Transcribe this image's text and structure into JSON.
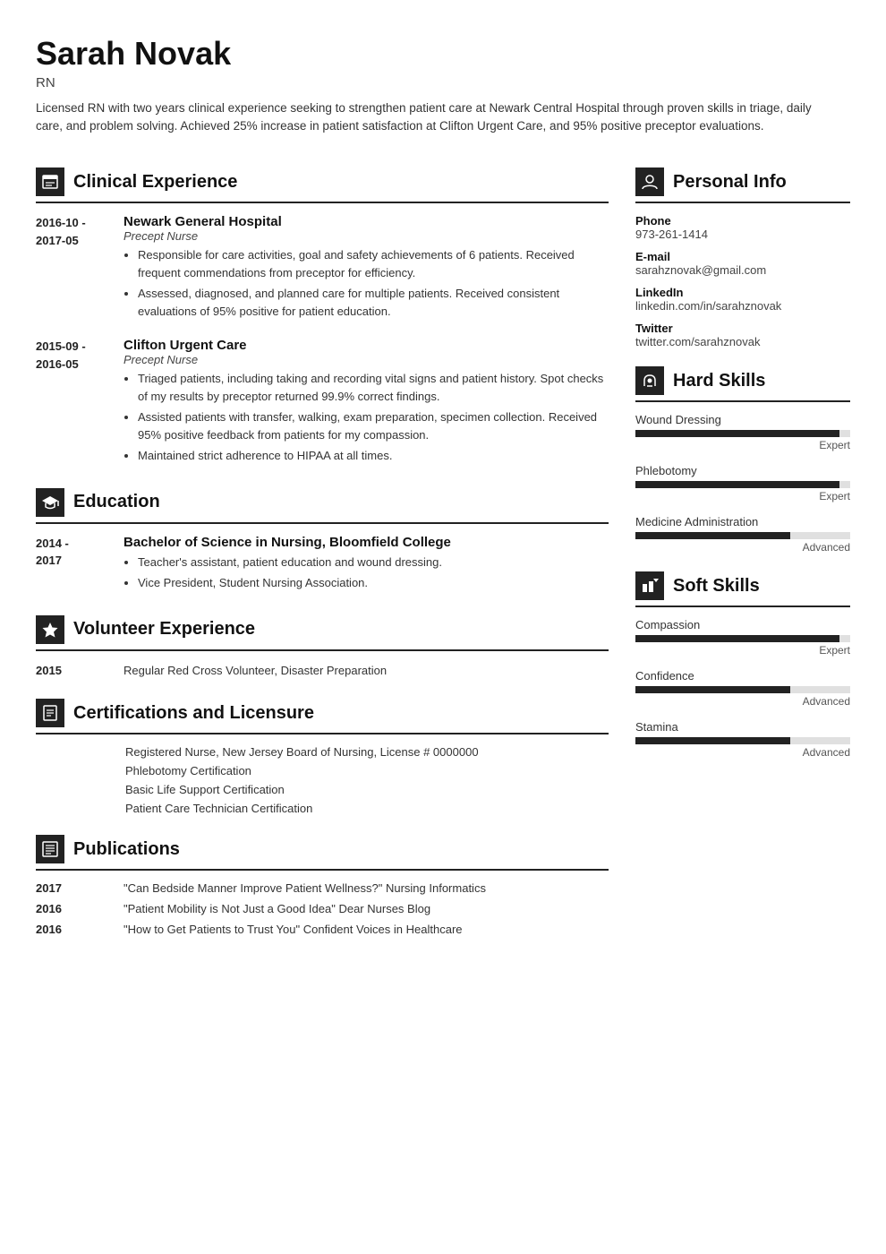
{
  "header": {
    "name": "Sarah Novak",
    "title": "RN",
    "summary": "Licensed RN with two years clinical experience seeking to strengthen patient care at Newark Central Hospital through proven skills in triage, daily care, and problem solving. Achieved 25% increase in patient satisfaction at Clifton Urgent Care, and 95% positive preceptor evaluations."
  },
  "left": {
    "clinical_experience": {
      "section_title": "Clinical Experience",
      "entries": [
        {
          "date": "2016-10 -\n2017-05",
          "company": "Newark General Hospital",
          "role": "Precept Nurse",
          "bullets": [
            "Responsible for care activities, goal and safety achievements of 6 patients. Received frequent commendations from preceptor for efficiency.",
            "Assessed, diagnosed, and planned care for multiple patients. Received consistent evaluations of 95% positive for patient education."
          ]
        },
        {
          "date": "2015-09 -\n2016-05",
          "company": "Clifton Urgent Care",
          "role": "Precept Nurse",
          "bullets": [
            "Triaged patients, including taking and recording vital signs and patient history. Spot checks of my results by preceptor returned 99.9% correct findings.",
            "Assisted patients with transfer, walking, exam preparation, specimen collection. Received 95% positive feedback from patients for my compassion.",
            "Maintained strict adherence to HIPAA at all times."
          ]
        }
      ]
    },
    "education": {
      "section_title": "Education",
      "entries": [
        {
          "date": "2014 -\n2017",
          "degree": "Bachelor of Science in Nursing, Bloomfield College",
          "bullets": [
            "Teacher's assistant, patient education and wound dressing.",
            "Vice President, Student Nursing Association."
          ]
        }
      ]
    },
    "volunteer": {
      "section_title": "Volunteer Experience",
      "entries": [
        {
          "date": "2015",
          "text": "Regular Red Cross Volunteer, Disaster Preparation"
        }
      ]
    },
    "certifications": {
      "section_title": "Certifications and Licensure",
      "items": [
        "Registered Nurse, New Jersey Board of Nursing, License # 0000000",
        "Phlebotomy Certification",
        "Basic Life Support Certification",
        "Patient Care Technician Certification"
      ]
    },
    "publications": {
      "section_title": "Publications",
      "entries": [
        {
          "year": "2017",
          "text": "\"Can Bedside Manner Improve Patient Wellness?\" Nursing Informatics"
        },
        {
          "year": "2016",
          "text": "\"Patient Mobility is Not Just a Good Idea\" Dear Nurses Blog"
        },
        {
          "year": "2016",
          "text": "\"How to Get Patients to Trust You\" Confident Voices in Healthcare"
        }
      ]
    }
  },
  "right": {
    "personal_info": {
      "section_title": "Personal Info",
      "items": [
        {
          "label": "Phone",
          "value": "973-261-1414"
        },
        {
          "label": "E-mail",
          "value": "sarahznovak@gmail.com"
        },
        {
          "label": "LinkedIn",
          "value": "linkedin.com/in/sarahznovak"
        },
        {
          "label": "Twitter",
          "value": "twitter.com/sarahznovak"
        }
      ]
    },
    "hard_skills": {
      "section_title": "Hard Skills",
      "items": [
        {
          "name": "Wound Dressing",
          "level": "Expert",
          "percent": 95
        },
        {
          "name": "Phlebotomy",
          "level": "Expert",
          "percent": 95
        },
        {
          "name": "Medicine Administration",
          "level": "Advanced",
          "percent": 72
        }
      ]
    },
    "soft_skills": {
      "section_title": "Soft Skills",
      "items": [
        {
          "name": "Compassion",
          "level": "Expert",
          "percent": 95
        },
        {
          "name": "Confidence",
          "level": "Advanced",
          "percent": 72
        },
        {
          "name": "Stamina",
          "level": "Advanced",
          "percent": 72
        }
      ]
    }
  },
  "icons": {
    "clinical": "🗂",
    "education": "🎓",
    "volunteer": "⭐",
    "certifications": "🔖",
    "publications": "📋",
    "personal_info": "👤",
    "hard_skills": "🔧",
    "soft_skills": "🏁"
  }
}
